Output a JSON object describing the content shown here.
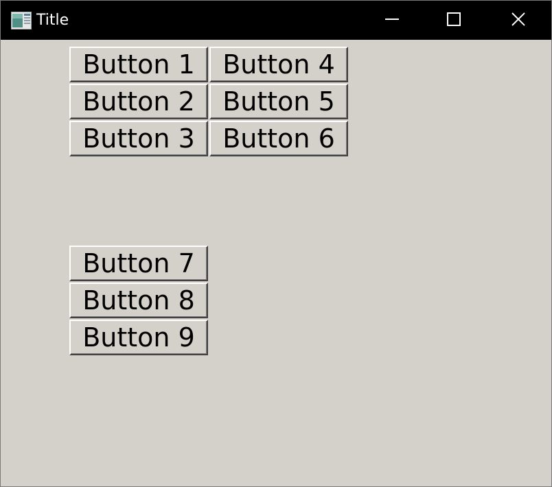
{
  "window": {
    "title": "Title",
    "app_icon": "app-window-icon",
    "controls": {
      "minimize_icon": "minimize-icon",
      "maximize_icon": "maximize-icon",
      "close_icon": "close-icon"
    }
  },
  "buttons": {
    "b1": "Button 1",
    "b2": "Button 2",
    "b3": "Button 3",
    "b4": "Button 4",
    "b5": "Button 5",
    "b6": "Button 6",
    "b7": "Button 7",
    "b8": "Button 8",
    "b9": "Button 9"
  },
  "colors": {
    "titlebar": "#000000",
    "client_background": "#d4d0ca",
    "button_face": "#d4d0ca",
    "text": "#000000"
  }
}
